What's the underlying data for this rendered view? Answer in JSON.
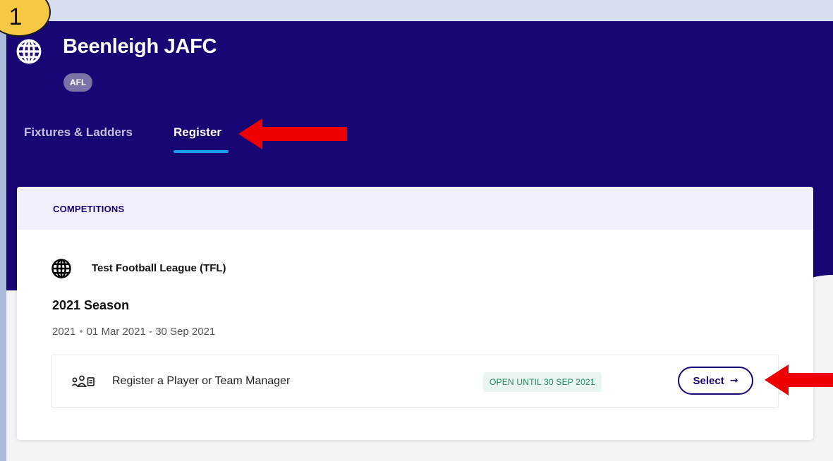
{
  "annotation": {
    "step_number": "1",
    "arrow_color": "#ee0000"
  },
  "header": {
    "org_icon": "globe-icon",
    "org_name": "Beenleigh JAFC",
    "sport_badge": "AFL",
    "background_color": "#180675"
  },
  "tabs": [
    {
      "label": "Fixtures & Ladders",
      "active": false
    },
    {
      "label": "Register",
      "active": true
    }
  ],
  "competitions": {
    "header_label": "COMPETITIONS",
    "competition": {
      "icon": "globe-icon",
      "name": "Test Football League (TFL)",
      "season": {
        "title": "2021 Season",
        "year": "2021",
        "date_range": "01 Mar 2021 - 30 Sep 2021",
        "registration": {
          "icon": "player-manager-icon",
          "label": "Register a Player or Team Manager",
          "status": "OPEN UNTIL 30 SEP 2021",
          "button_label": "Select",
          "button_icon": "arrow-right-icon"
        }
      }
    }
  },
  "colors": {
    "accent": "#180675",
    "tab_indicator": "#1d9bf0",
    "open_status": "#1f8a5b"
  }
}
